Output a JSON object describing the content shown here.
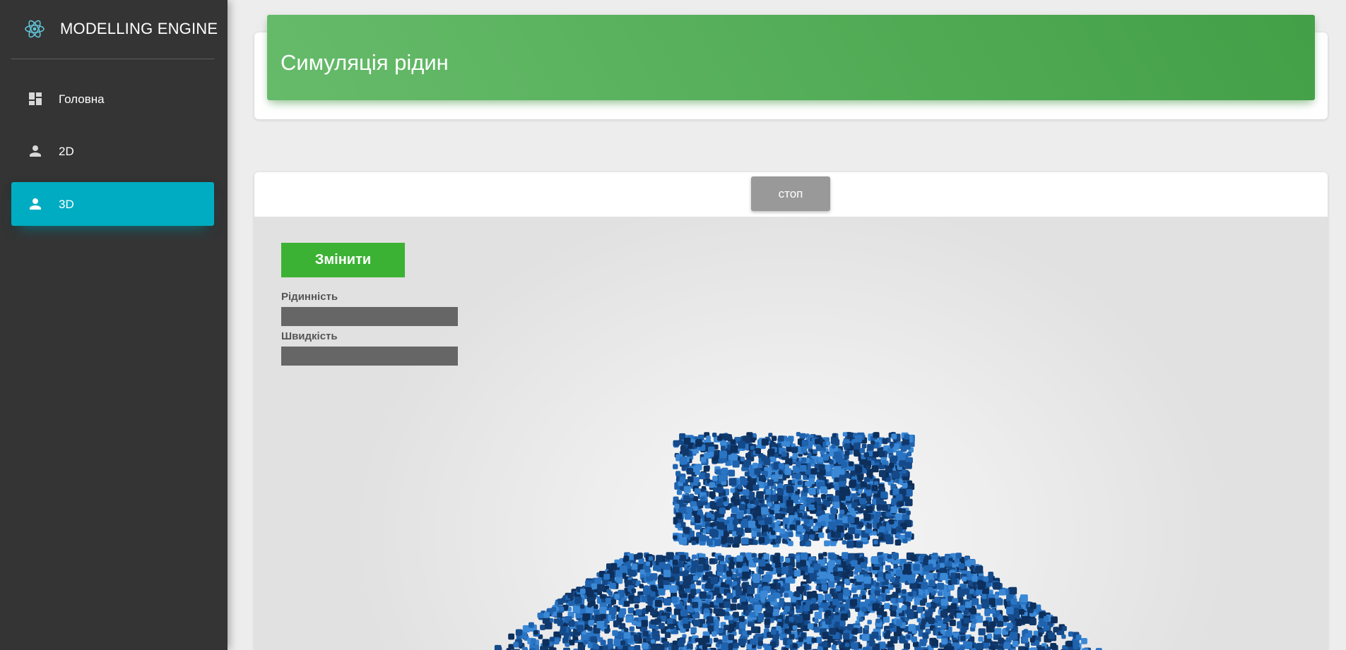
{
  "brand": {
    "title": "MODELLING ENGINE",
    "logo_icon": "react-atom-icon"
  },
  "sidebar": {
    "items": [
      {
        "label": "Головна",
        "icon": "dashboard-icon",
        "active": false
      },
      {
        "label": "2D",
        "icon": "person-icon",
        "active": false
      },
      {
        "label": "3D",
        "icon": "person-icon",
        "active": true
      }
    ]
  },
  "header": {
    "title": "Симуляція рідин"
  },
  "simulation": {
    "stop_label": "стоп",
    "change_label": "Змінити",
    "params": [
      {
        "label": "Рідинність"
      },
      {
        "label": "Швидкість"
      }
    ]
  },
  "colors": {
    "sidebar_bg": "#343434",
    "active_nav": "#00acc1",
    "header_gradient_start": "#66bb6a",
    "header_gradient_end": "#43a047",
    "change_button": "#3cb234",
    "stop_button": "#999999",
    "particles": "#1f62ad"
  }
}
